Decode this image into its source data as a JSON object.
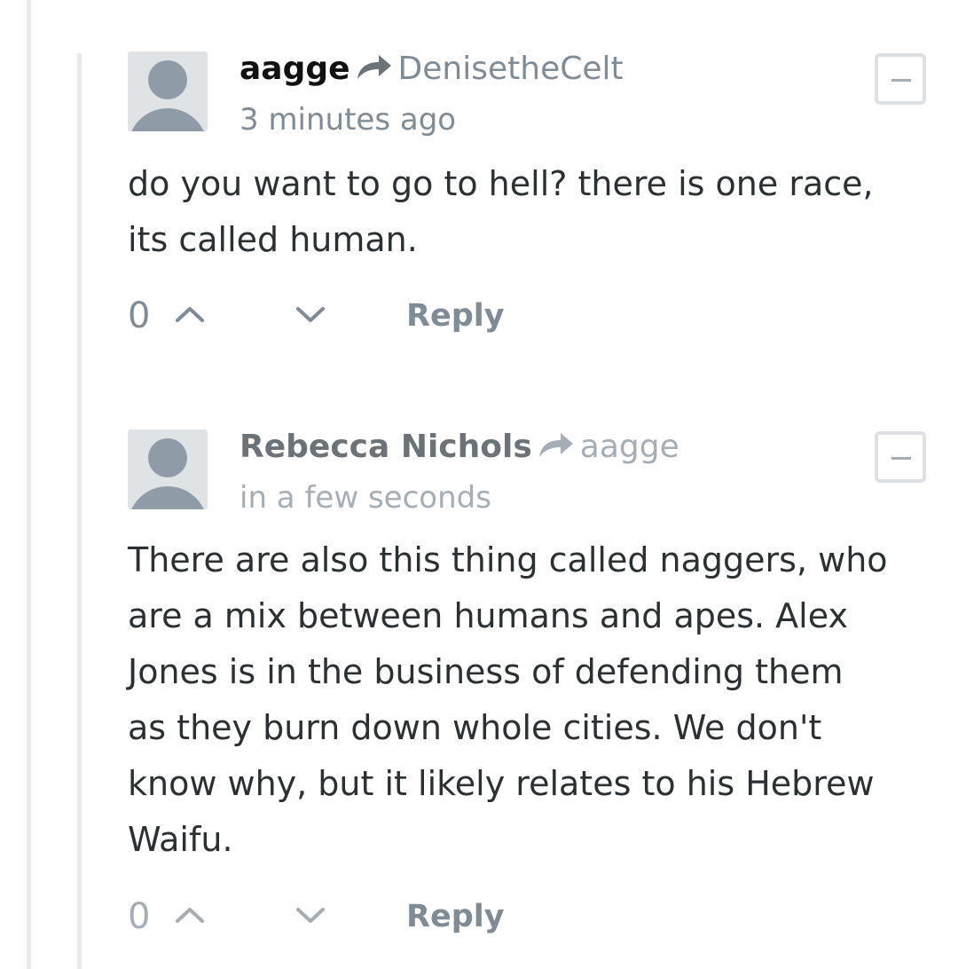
{
  "comments": [
    {
      "author": "aagge",
      "author_color": "#111111",
      "reply_to": "DenisetheCelt",
      "timestamp": "3 minutes ago",
      "body_lines": [
        "do you want to go to hell? there is one race,",
        "its called human."
      ],
      "votes": "0",
      "reply_label": "Reply"
    },
    {
      "author": "Rebecca Nichols",
      "author_color": "#6c7378",
      "reply_to": "aagge",
      "timestamp": "in a few seconds",
      "body_lines": [
        "There are also this thing called naggers, who",
        "are a mix between humans and apes. Alex",
        "Jones is in the business of defending them",
        "as they burn down whole cities. We don't",
        "know why, but it likely relates to his Hebrew",
        "Waifu."
      ],
      "votes": "0",
      "reply_label": "Reply"
    }
  ],
  "icons": {
    "reply_arrow": "share-arrow-icon",
    "upvote": "chevron-up-icon",
    "downvote": "chevron-down-icon",
    "collapse": "minus-icon"
  },
  "colors": {
    "muted": "#7f8b95",
    "body_text": "#2b3033",
    "thread_line": "#e7e9ec",
    "avatar_bg": "#dfe3e6",
    "avatar_fg": "#8f9ba6"
  }
}
